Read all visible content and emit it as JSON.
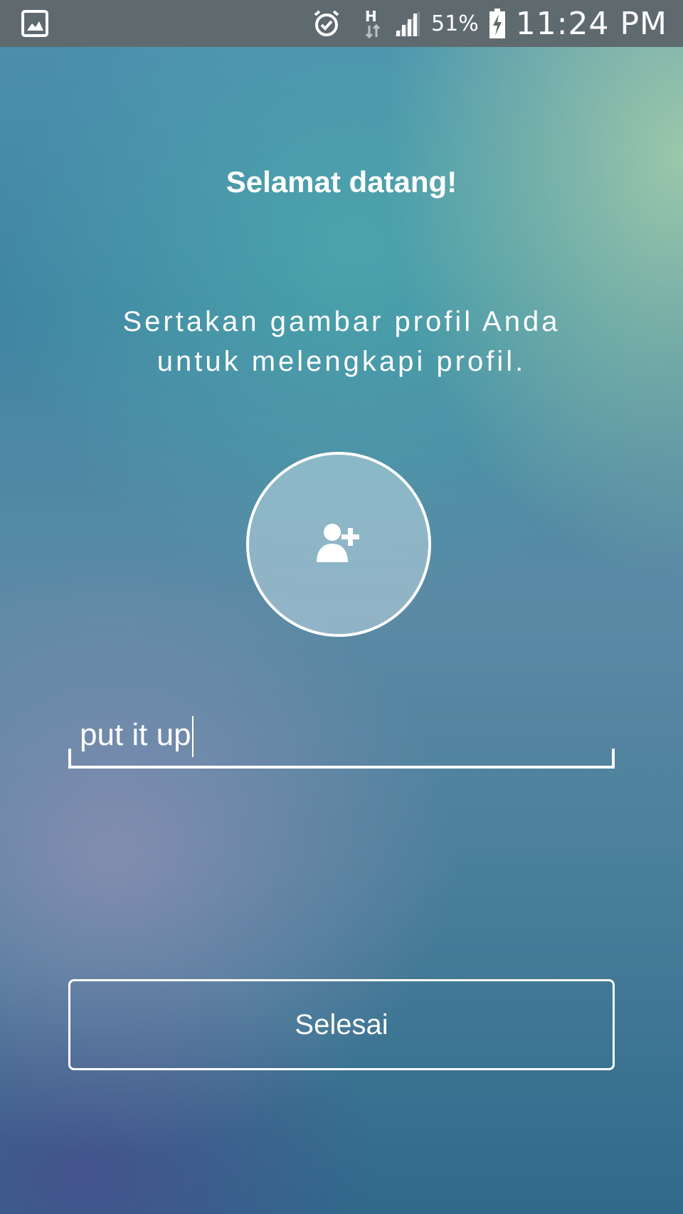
{
  "status_bar": {
    "battery_percent": "51%",
    "time": "11:24 PM",
    "icons": [
      "gallery-notification-icon",
      "alarm-icon",
      "hspa-data-icon",
      "signal-icon",
      "battery-charging-icon"
    ]
  },
  "welcome": {
    "title": "Selamat datang!",
    "subtitle_line1": "Sertakan gambar profil Anda",
    "subtitle_line2": "untuk melengkapi profil."
  },
  "profile_picture": {
    "icon": "add-user-icon"
  },
  "name_input": {
    "value": "put it up"
  },
  "actions": {
    "done_label": "Selesai"
  },
  "colors": {
    "status_bar": "#5f6a6f",
    "text": "#ffffff"
  }
}
